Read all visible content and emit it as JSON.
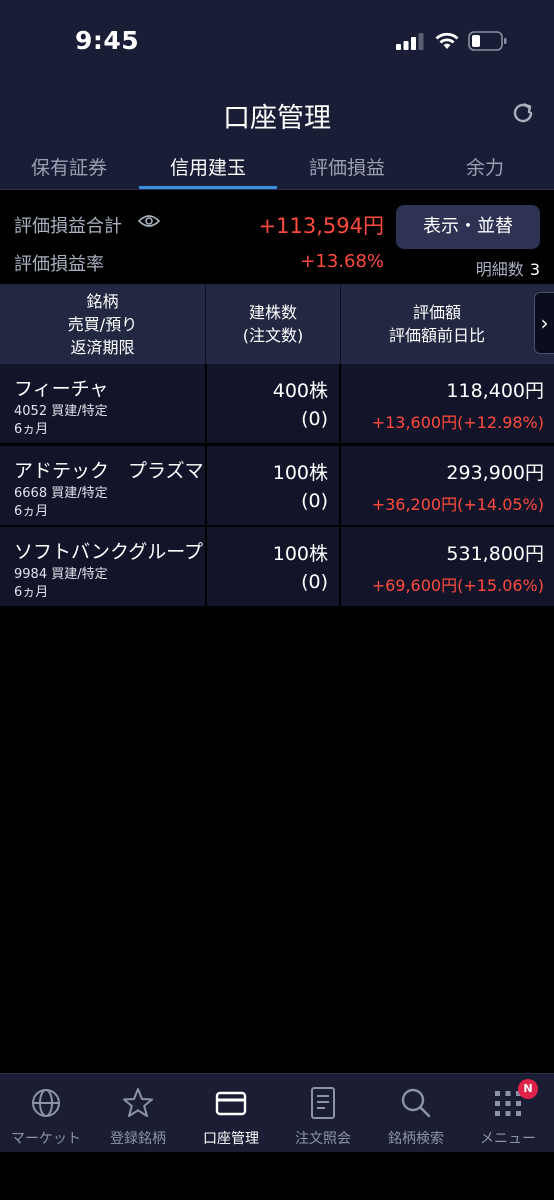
{
  "status_bar": {
    "time": "9:45"
  },
  "header": {
    "title": "口座管理",
    "refresh_icon": "refresh-icon"
  },
  "tabs": [
    {
      "label": "保有証券",
      "active": false
    },
    {
      "label": "信用建玉",
      "active": true
    },
    {
      "label": "評価損益",
      "active": false
    },
    {
      "label": "余力",
      "active": false
    }
  ],
  "summary": {
    "total_label": "評価損益合計",
    "total_value": "+113,594円",
    "rate_label": "評価損益率",
    "rate_value": "+13.68%",
    "display_button": "表示・並替",
    "detail_count_label": "明細数",
    "detail_count": "3"
  },
  "table": {
    "headers": {
      "col1": [
        "銘柄",
        "売買/預り",
        "返済期限"
      ],
      "col2": [
        "建株数",
        "(注文数)"
      ],
      "col3": [
        "評価額",
        "評価額前日比"
      ]
    },
    "rows": [
      {
        "name": "フィーチャ",
        "code": "4052 買建/特定",
        "term": "6ヵ月",
        "qty": "400株",
        "order": "(0)",
        "value": "118,400円",
        "diff": "+13,600円(+12.98%)"
      },
      {
        "name": "アドテック　プラズマ",
        "code": "6668 買建/特定",
        "term": "6ヵ月",
        "qty": "100株",
        "order": "(0)",
        "value": "293,900円",
        "diff": "+36,200円(+14.05%)"
      },
      {
        "name": "ソフトバンクグループ",
        "code": "9984 買建/特定",
        "term": "6ヵ月",
        "qty": "100株",
        "order": "(0)",
        "value": "531,800円",
        "diff": "+69,600円(+15.06%)"
      }
    ]
  },
  "bottom_nav": [
    {
      "label": "マーケット",
      "icon": "globe-icon",
      "active": false
    },
    {
      "label": "登録銘柄",
      "icon": "star-icon",
      "active": false
    },
    {
      "label": "口座管理",
      "icon": "card-icon",
      "active": true
    },
    {
      "label": "注文照会",
      "icon": "document-icon",
      "active": false
    },
    {
      "label": "銘柄検索",
      "icon": "search-icon",
      "active": false
    },
    {
      "label": "メニュー",
      "icon": "grid-menu-icon",
      "active": false,
      "badge": "N"
    }
  ],
  "colors": {
    "positive": "#ff4a3d",
    "accent": "#3d8dde",
    "header_bg": "#191d35"
  }
}
